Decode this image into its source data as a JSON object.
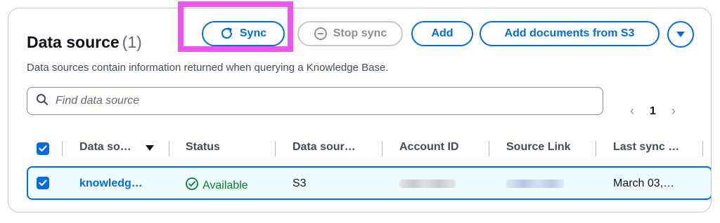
{
  "header": {
    "title": "Data source",
    "count": "(1)",
    "description": "Data sources contain information returned when querying a Knowledge Base."
  },
  "actions": {
    "sync": "Sync",
    "stop_sync": "Stop sync",
    "add": "Add",
    "add_documents": "Add documents from S3"
  },
  "search": {
    "placeholder": "Find data source",
    "value": ""
  },
  "pagination": {
    "current_page": "1"
  },
  "table": {
    "columns": [
      "Data so…",
      "Status",
      "Data sour…",
      "Account ID",
      "Source Link",
      "Last sync …"
    ],
    "rows": [
      {
        "name": "knowledg…",
        "status": "Available",
        "type": "S3",
        "account_id": "",
        "source_link": "",
        "last_sync": "March 03,…"
      }
    ]
  },
  "colors": {
    "accent": "#006ce0",
    "success": "#00802f",
    "highlight": "#ee55ee"
  }
}
